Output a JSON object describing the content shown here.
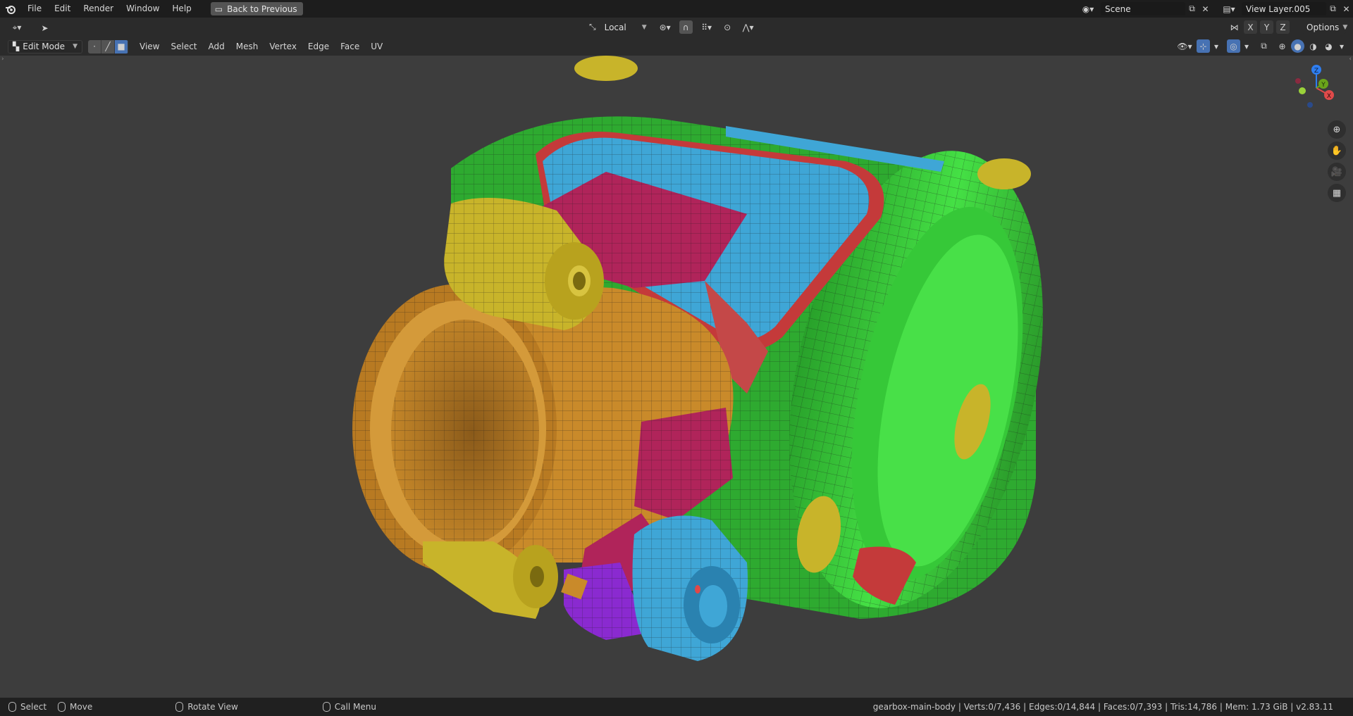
{
  "topbar": {
    "menus": [
      "File",
      "Edit",
      "Render",
      "Window",
      "Help"
    ],
    "back_label": "Back to Previous",
    "scene_label": "Scene",
    "view_layer_label": "View Layer.005"
  },
  "toolheader": {
    "transform_orientation": "Local",
    "options_label": "Options",
    "axes": [
      "X",
      "Y",
      "Z"
    ]
  },
  "vpheader": {
    "mode_label": "Edit Mode",
    "menus": [
      "View",
      "Select",
      "Add",
      "Mesh",
      "Vertex",
      "Edge",
      "Face",
      "UV"
    ]
  },
  "gizmo": {
    "x": "X",
    "y": "Y",
    "z": "Z"
  },
  "status": {
    "select": "Select",
    "move": "Move",
    "rotate": "Rotate View",
    "call_menu": "Call Menu",
    "stats": "gearbox-main-body | Verts:0/7,436 | Edges:0/14,844 | Faces:0/7,393 | Tris:14,786 | Mem: 1.73 GiB | v2.83.11"
  },
  "colors": {
    "green": "#3ec83a",
    "blue": "#3fa6d6",
    "magenta": "#b0245a",
    "orange": "#c98a2a",
    "yellow": "#c8b42a",
    "purple": "#8a2ad0",
    "red": "#c43a3a"
  }
}
